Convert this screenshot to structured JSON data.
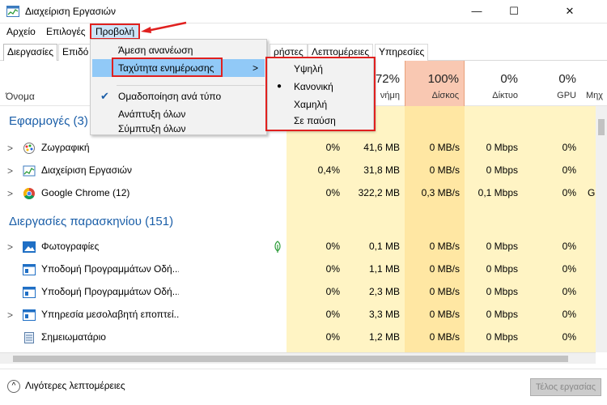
{
  "window": {
    "title": "Διαχείριση Εργασιών",
    "minimize": "—",
    "maximize": "☐",
    "close": "✕"
  },
  "menubar": {
    "file": "Αρχείο",
    "options": "Επιλογές",
    "view": "Προβολή"
  },
  "tabs": [
    "Διεργασίες",
    "Επιδό",
    "ρήστες",
    "Λεπτομέρειες",
    "Υπηρεσίες"
  ],
  "columns": {
    "name": "Όνομα",
    "memory": {
      "pct": "72%",
      "label": "νήμη"
    },
    "disk": {
      "pct": "100%",
      "label": "Δίσκος"
    },
    "network": {
      "pct": "0%",
      "label": "Δίκτυο"
    },
    "gpu": {
      "pct": "0%",
      "label": "GPU"
    },
    "gpu_engine": {
      "label": "Μηχ"
    }
  },
  "sections": {
    "apps": "Εφαρμογές (3)",
    "background": "Διεργασίες παρασκηνίου (151)"
  },
  "apps": [
    {
      "name": "Ζωγραφική",
      "cpu": "0%",
      "memory": "41,6 MB",
      "disk": "0 MB/s",
      "network": "0 Mbps",
      "gpu": "0%",
      "gpu_engine": ""
    },
    {
      "name": "Διαχείριση Εργασιών",
      "cpu": "0,4%",
      "memory": "31,8 MB",
      "disk": "0 MB/s",
      "network": "0 Mbps",
      "gpu": "0%",
      "gpu_engine": ""
    },
    {
      "name": "Google Chrome (12)",
      "cpu": "0%",
      "memory": "322,2 MB",
      "disk": "0,3 MB/s",
      "network": "0,1 Mbps",
      "gpu": "0%",
      "gpu_engine": "G"
    }
  ],
  "background": [
    {
      "name": "Φωτογραφίες",
      "cpu": "0%",
      "memory": "0,1 MB",
      "disk": "0 MB/s",
      "network": "0 Mbps",
      "gpu": "0%"
    },
    {
      "name": "Υποδομή Προγραμμάτων Οδή...",
      "cpu": "0%",
      "memory": "1,1 MB",
      "disk": "0 MB/s",
      "network": "0 Mbps",
      "gpu": "0%"
    },
    {
      "name": "Υποδομή Προγραμμάτων Οδή...",
      "cpu": "0%",
      "memory": "2,3 MB",
      "disk": "0 MB/s",
      "network": "0 Mbps",
      "gpu": "0%"
    },
    {
      "name": "Υπηρεσία μεσολαβητή εποπτεί...",
      "cpu": "0%",
      "memory": "3,3 MB",
      "disk": "0 MB/s",
      "network": "0 Mbps",
      "gpu": "0%"
    },
    {
      "name": "Σημειωματάριο",
      "cpu": "0%",
      "memory": "1,2 MB",
      "disk": "0 MB/s",
      "network": "0 Mbps",
      "gpu": "0%"
    }
  ],
  "view_menu": {
    "refresh_now": "Άμεση ανανέωση",
    "update_speed": "Ταχύτητα ενημέρωσης",
    "group_by_type": "Ομαδοποίηση ανά τύπο",
    "expand_all": "Ανάπτυξη όλων",
    "collapse_all": "Σύμπτυξη όλων"
  },
  "speed_menu": {
    "high": "Υψηλή",
    "normal": "Κανονική",
    "low": "Χαμηλή",
    "paused": "Σε παύση"
  },
  "footer": {
    "fewer_details": "Λιγότερες λεπτομέρειες",
    "end_task": "Τέλος εργασίας"
  },
  "colors": {
    "accent": "#1a5ea8",
    "highlight": "#e0201f",
    "disk_column": "#f9c8b2",
    "usage_shade": "#fff4c4"
  }
}
